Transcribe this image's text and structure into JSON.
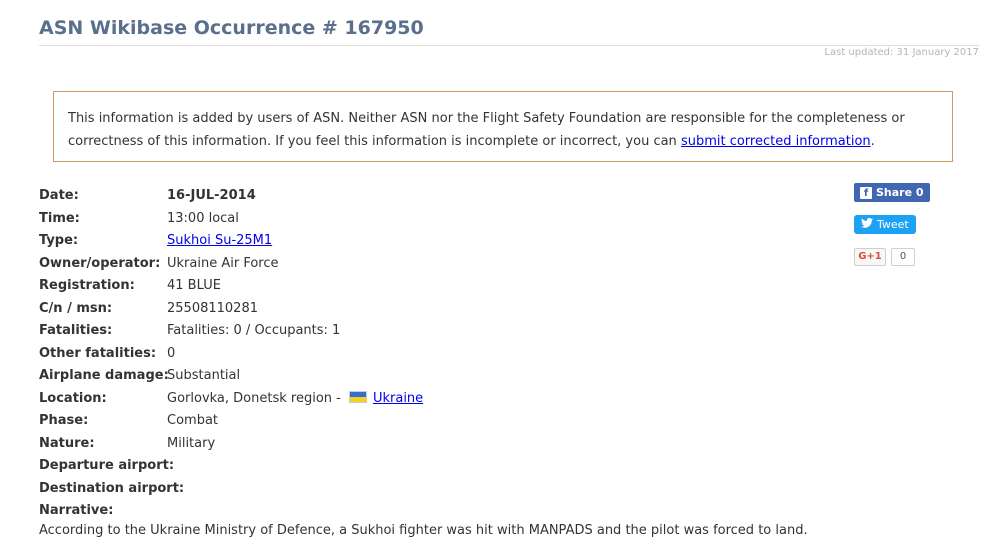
{
  "page": {
    "title": "ASN Wikibase Occurrence # 167950",
    "last_updated": "Last updated: 31 January 2017"
  },
  "notice": {
    "text_before": "This information is added by users of ASN. Neither ASN nor the Flight Safety Foundation are responsible for the completeness or correctness of this information. If you feel this information is incomplete or incorrect, you can ",
    "link_text": "submit corrected information",
    "text_after": "."
  },
  "details": {
    "date": {
      "label": "Date:",
      "value": "16-JUL-2014"
    },
    "time": {
      "label": "Time:",
      "value": "13:00 local"
    },
    "type": {
      "label": "Type:",
      "value": "Sukhoi Su-25M1"
    },
    "owner": {
      "label": "Owner/operator:",
      "value": "Ukraine Air Force"
    },
    "registration": {
      "label": "Registration:",
      "value": "41 BLUE"
    },
    "cn_msn": {
      "label": "C/n / msn:",
      "value": "25508110281"
    },
    "fatalities": {
      "label": "Fatalities:",
      "value": "Fatalities: 0 / Occupants: 1"
    },
    "other_fatalities": {
      "label": "Other fatalities:",
      "value": "0"
    },
    "damage": {
      "label": "Airplane damage:",
      "value": "Substantial"
    },
    "location": {
      "label": "Location:",
      "value": "Gorlovka, Donetsk region - ",
      "country": "Ukraine"
    },
    "phase": {
      "label": "Phase:",
      "value": "Combat"
    },
    "nature": {
      "label": "Nature:",
      "value": "Military"
    },
    "departure": {
      "label": "Departure airport:",
      "value": ""
    },
    "destination": {
      "label": "Destination airport:",
      "value": ""
    },
    "narrative_label": {
      "label": "Narrative:"
    }
  },
  "narrative": "According to the Ukraine Ministry of Defence, a Sukhoi fighter was hit with MANPADS and the pilot was forced to land.",
  "social": {
    "facebook": {
      "icon": "f",
      "label": "Share 0"
    },
    "twitter": {
      "label": "Tweet"
    },
    "gplus": {
      "label": "G+1",
      "count": "0"
    }
  },
  "colors": {
    "title": "#5a6f8c",
    "notice_border": "#cf9a5d",
    "link": "#0000ee",
    "facebook": "#4267b2",
    "twitter": "#1da1f2"
  }
}
